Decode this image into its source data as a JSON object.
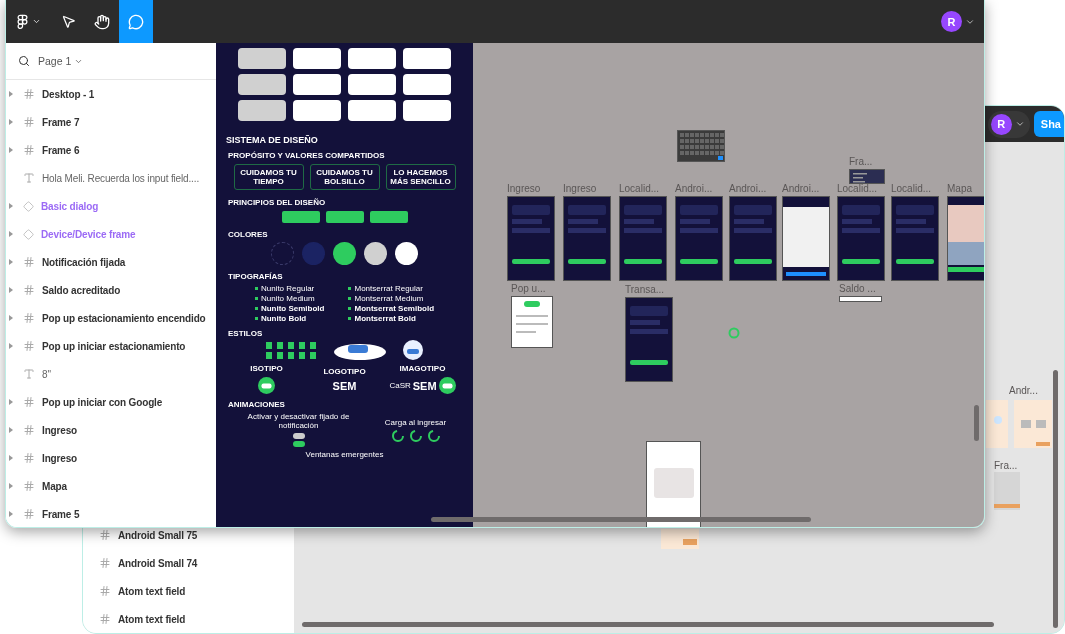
{
  "back_window": {
    "avatar": "R",
    "share_button": "Sha",
    "layers": [
      {
        "name": "Android Small 75"
      },
      {
        "name": "Android Small 74"
      },
      {
        "name": "Atom text field"
      },
      {
        "name": "Atom text field"
      }
    ],
    "canvas_labels": [
      "Andr...",
      "Fra..."
    ]
  },
  "front_window": {
    "toolbar": {
      "tools": [
        {
          "kind": "menu",
          "selected": false
        },
        {
          "kind": "move",
          "selected": false
        },
        {
          "kind": "hand",
          "selected": false
        },
        {
          "kind": "comment",
          "selected": true
        }
      ],
      "avatar": "R"
    },
    "layers_panel": {
      "page": "Page 1",
      "layers": [
        {
          "name": "Desktop - 1",
          "kind": "frame"
        },
        {
          "name": "Frame 7",
          "kind": "frame"
        },
        {
          "name": "Frame 6",
          "kind": "frame"
        },
        {
          "name": "Hola Meli. Recuerda los input field....",
          "kind": "text"
        },
        {
          "name": "Basic dialog",
          "kind": "component"
        },
        {
          "name": "Device/Device frame",
          "kind": "component"
        },
        {
          "name": "Notificación fijada",
          "kind": "frame"
        },
        {
          "name": "Saldo acreditado",
          "kind": "frame"
        },
        {
          "name": "Pop up estacionamiento encendido",
          "kind": "frame"
        },
        {
          "name": "Pop up iniciar estacionamiento",
          "kind": "frame"
        },
        {
          "name": "8\"",
          "kind": "text"
        },
        {
          "name": "Pop up iniciar con Google",
          "kind": "frame"
        },
        {
          "name": "Ingreso",
          "kind": "frame"
        },
        {
          "name": "Ingreso",
          "kind": "frame"
        },
        {
          "name": "Mapa",
          "kind": "frame"
        },
        {
          "name": "Frame 5",
          "kind": "frame"
        }
      ]
    },
    "design_frame": {
      "title": "SISTEMA DE DISEÑO",
      "values_heading": "PROPÓSITO Y VALORES COMPARTIDOS",
      "values": [
        "CUIDAMOS TU TIEMPO",
        "CUIDAMOS TU BOLSILLO",
        "LO HACEMOS MÁS SENCILLO"
      ],
      "principles_heading": "PRINCIPIOS DEL DISEÑO",
      "colors_heading": "COLORES",
      "swatches": [
        {
          "color": "#13113a"
        },
        {
          "color": "#1b2363"
        },
        {
          "color": "#2ecc5f"
        },
        {
          "color": "#d0d0d0"
        },
        {
          "color": "#ffffff"
        }
      ],
      "typography_heading": "TIPOGRAFÍAS",
      "fonts": [
        [
          "Nunito Regular",
          "Nunito Medium",
          "Nunito Semibold",
          "Nunito Bold"
        ],
        [
          "Montserrat Regular",
          "Montserrat Medium",
          "Montserrat Semibold",
          "Montserrat Bold"
        ]
      ],
      "styles_heading": "ESTILOS",
      "logos": [
        {
          "label": "ISOTIPO",
          "kind": "icon"
        },
        {
          "label": "LOGOTIPO",
          "kind": "word",
          "word": "SEM"
        },
        {
          "label": "IMAGOTIPO",
          "kind": "both",
          "word": "SEM",
          "prefix": "CaSR"
        }
      ],
      "animations_heading": "ANIMACIONES",
      "animations": [
        "Activar y desactivar fijado de notificación",
        "Carga al ingresar"
      ],
      "popups_caption": "Ventanas emergentes"
    },
    "canvas": {
      "frames": [
        {
          "kind": "keyboard"
        },
        {
          "label": "Fra...",
          "kind": "menu"
        },
        {
          "label": "Ingreso",
          "kind": "dark"
        },
        {
          "label": "Ingreso",
          "kind": "dark"
        },
        {
          "label": "Localid...",
          "kind": "dark"
        },
        {
          "label": "Androi...",
          "kind": "dark"
        },
        {
          "label": "Androi...",
          "kind": "dark"
        },
        {
          "label": "Androi...",
          "kind": "light"
        },
        {
          "label": "Localid...",
          "kind": "dark"
        },
        {
          "label": "Localid...",
          "kind": "dark"
        },
        {
          "label": "Mapa",
          "kind": "map"
        },
        {
          "label": "Pop u...",
          "kind": "popup"
        },
        {
          "label": "Transa...",
          "kind": "dark"
        },
        {
          "label": "Saldo ...",
          "kind": "strip"
        },
        {
          "kind": "dialog"
        }
      ]
    }
  }
}
